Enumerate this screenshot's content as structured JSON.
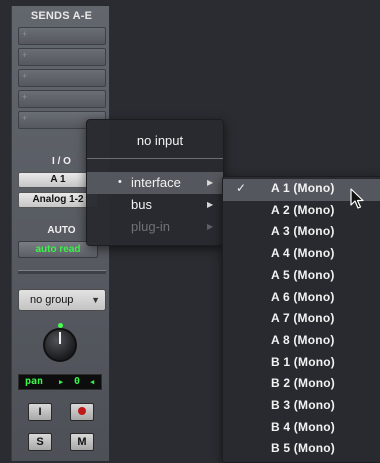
{
  "sends": {
    "header": "SENDS A-E",
    "slots": [
      "+",
      "+",
      "+",
      "+",
      "+"
    ]
  },
  "io": {
    "label": "I / O",
    "input": "A 1",
    "output": "Analog 1-2"
  },
  "automation": {
    "label": "AUTO",
    "mode": "auto read"
  },
  "group": {
    "value": "no group"
  },
  "pan": {
    "label": "pan",
    "value": "0"
  },
  "buttons": {
    "input_monitor": "I",
    "solo": "S",
    "mute": "M"
  },
  "input_menu": {
    "items": [
      {
        "label": "no input",
        "bullet": "",
        "disabled": false
      },
      {
        "label": "interface",
        "bullet": "•",
        "submenu": true,
        "highlighted": true
      },
      {
        "label": "bus",
        "submenu": true
      },
      {
        "label": "plug-in",
        "submenu": true,
        "disabled": true
      }
    ]
  },
  "interface_submenu": {
    "checked_mark": "✓",
    "selected": "A 1 (Mono)",
    "items": [
      "A 1 (Mono)",
      "A 2 (Mono)",
      "A 3 (Mono)",
      "A 4 (Mono)",
      "A 5 (Mono)",
      "A 6 (Mono)",
      "A 7 (Mono)",
      "A 8 (Mono)",
      "B 1 (Mono)",
      "B 2 (Mono)",
      "B 3 (Mono)",
      "B 4 (Mono)",
      "B 5 (Mono)"
    ]
  },
  "colors": {
    "led_green": "#3df24b",
    "highlight": "#54575d",
    "record_red": "#c01818"
  }
}
